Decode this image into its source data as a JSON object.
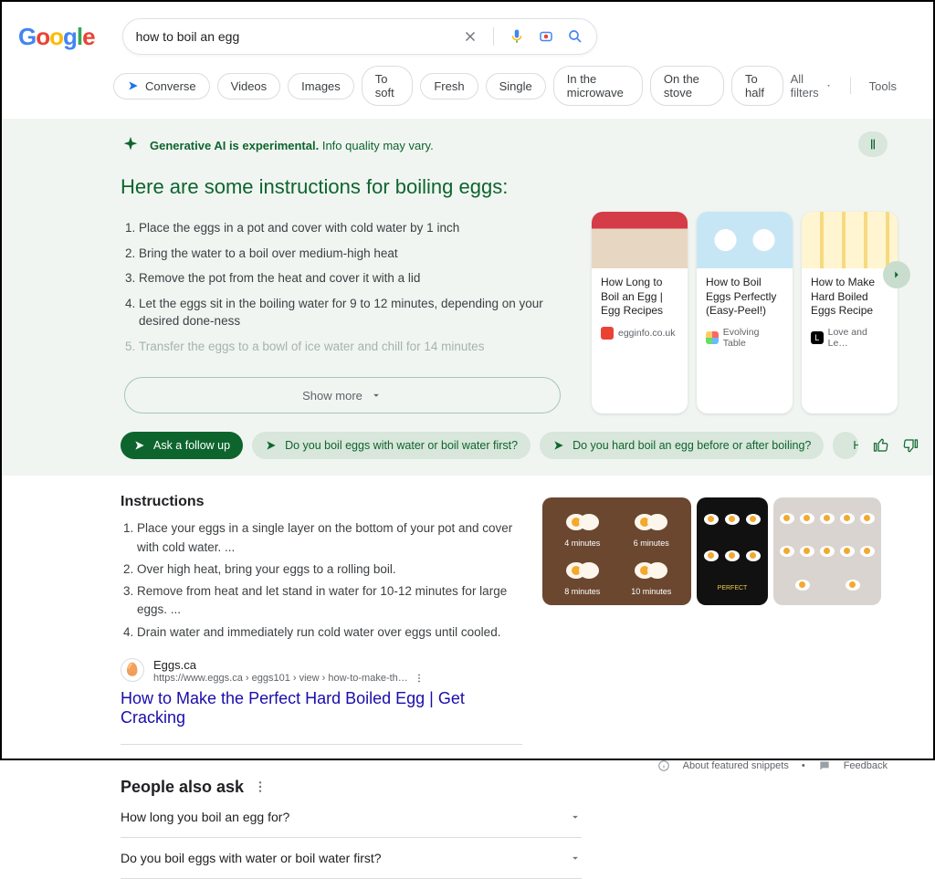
{
  "search": {
    "query": "how to boil an egg"
  },
  "chips": [
    "Converse",
    "Videos",
    "Images",
    "To soft",
    "Fresh",
    "Single",
    "In the microwave",
    "On the stove",
    "To half"
  ],
  "filters": {
    "all": "All filters",
    "tools": "Tools"
  },
  "sge": {
    "notice_bold": "Generative AI is experimental.",
    "notice_rest": " Info quality may vary.",
    "title": "Here are some instructions for boiling eggs:",
    "steps": [
      "Place the eggs in a pot and cover with cold water by 1 inch",
      "Bring the water to a boil over medium-high heat",
      "Remove the pot from the heat and cover it with a lid",
      "Let the eggs sit in the boiling water for 9 to 12 minutes, depending on your desired done-ness",
      "Transfer the eggs to a bowl of ice water and chill for 14 minutes"
    ],
    "show_more": "Show more",
    "cards": [
      {
        "title": "How Long to Boil an Egg | Egg Recipes -…",
        "source": "egginfo.co.uk"
      },
      {
        "title": "How to Boil Eggs Perfectly (Easy-Peel!) -…",
        "source": "Evolving Table"
      },
      {
        "title": "How to Make Hard Boiled Eggs Recipe -…",
        "source": "Love and Le…"
      }
    ],
    "follow": {
      "primary": "Ask a follow up",
      "items": [
        "Do you boil eggs with water or boil water first?",
        "Do you hard boil an egg before or after boiling?",
        "How long do"
      ]
    }
  },
  "result": {
    "heading": "Instructions",
    "steps": [
      "Place your eggs in a single layer on the bottom of your pot and cover with cold water. ...",
      "Over high heat, bring your eggs to a rolling boil.",
      "Remove from heat and let stand in water for 10-12 minutes for large eggs. ...",
      "Drain water and immediately run cold water over eggs until cooled."
    ],
    "source_name": "Eggs.ca",
    "source_url": "https://www.eggs.ca › eggs101 › view › how-to-make-th…",
    "link_title": "How to Make the Perfect Hard Boiled Egg | Get Cracking",
    "img_labels": [
      "4 minutes",
      "6 minutes",
      "8 minutes",
      "10 minutes"
    ],
    "perfect": "PERFECT",
    "about": "About featured snippets",
    "feedback": "Feedback"
  },
  "paa": {
    "title": "People also ask",
    "questions": [
      "How long you boil an egg for?",
      "Do you boil eggs with water or boil water first?"
    ]
  }
}
